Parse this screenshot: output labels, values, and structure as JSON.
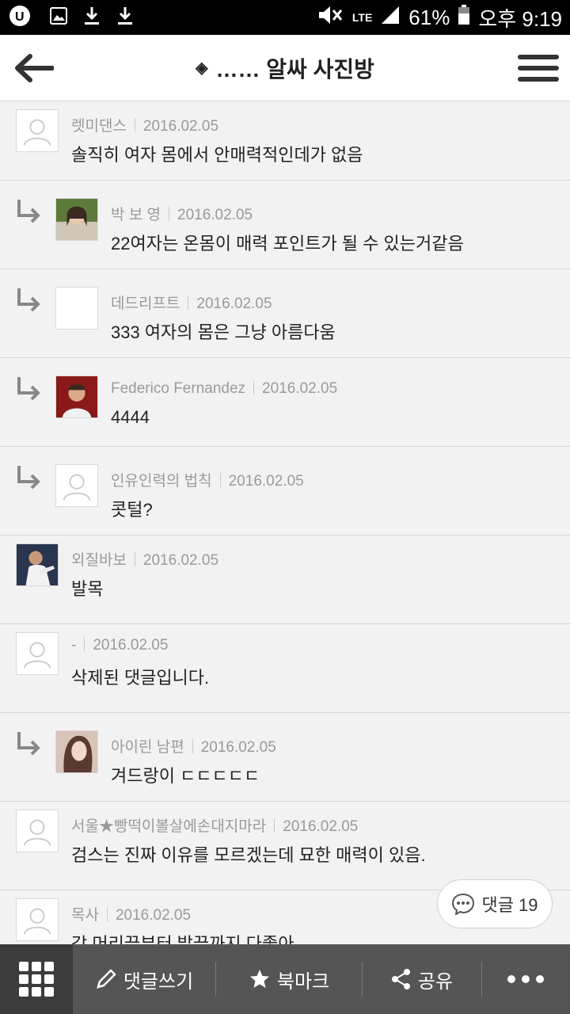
{
  "status_bar": {
    "network": "LTE",
    "battery": "61%",
    "time": "오후 9:19"
  },
  "header": {
    "title": "…… 알싸 사진방",
    "title_icon": "◈"
  },
  "comments": [
    {
      "user": "렛미댄스",
      "date": "2016.02.05",
      "text": "솔직히 여자 몸에서 안매력적인데가 없음",
      "reply": false,
      "avatar": "default"
    },
    {
      "user": "박 보 영",
      "date": "2016.02.05",
      "text": "22여자는 온몸이 매력 포인트가 될 수 있는거같음",
      "reply": true,
      "avatar": "photo-woman"
    },
    {
      "user": "데드리프트",
      "date": "2016.02.05",
      "text": "333 여자의 몸은 그냥 아름다움",
      "reply": true,
      "avatar": "blank"
    },
    {
      "user": "Federico Fernandez",
      "date": "2016.02.05",
      "text": "4444",
      "reply": true,
      "avatar": "photo-man"
    },
    {
      "user": "인유인력의 법칙",
      "date": "2016.02.05",
      "text": "콧털?",
      "reply": true,
      "avatar": "default"
    },
    {
      "user": "외질바보",
      "date": "2016.02.05",
      "text": "발목",
      "reply": false,
      "avatar": "photo-player"
    },
    {
      "user": "-",
      "date": "2016.02.05",
      "text": "삭제된 댓글입니다.",
      "reply": false,
      "avatar": "default"
    },
    {
      "user": "아이린 남편",
      "date": "2016.02.05",
      "text": "겨드랑이 ㄷㄷㄷㄷㄷ",
      "reply": true,
      "avatar": "photo-girl"
    },
    {
      "user": "서울★빵떡이볼살에손대지마라",
      "date": "2016.02.05",
      "text": "검스는 진짜 이유를 모르겠는데 묘한 매력이 있음.",
      "reply": false,
      "avatar": "default"
    },
    {
      "user": "목사",
      "date": "2016.02.05",
      "text": "각 머리끝부터 발끝까지 다좋아",
      "reply": false,
      "avatar": "default"
    }
  ],
  "floating": {
    "comment_label": "댓글 19"
  },
  "bottom_bar": {
    "write": "댓글쓰기",
    "bookmark": "북마크",
    "share": "공유"
  }
}
